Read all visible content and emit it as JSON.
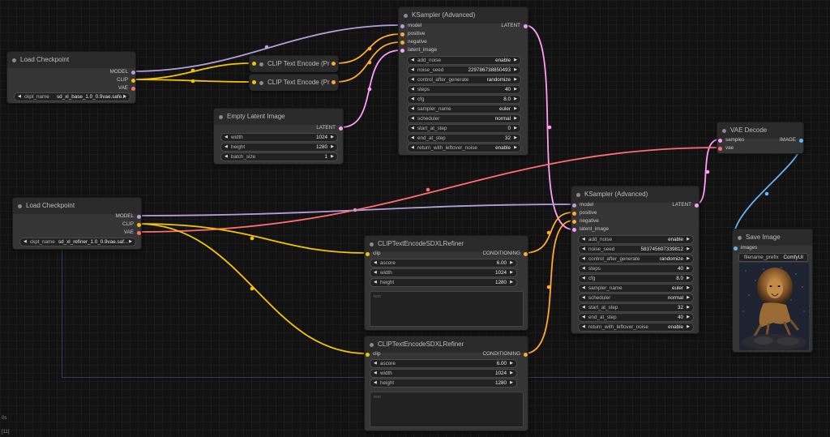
{
  "colors": {
    "model": "#b39ddb",
    "clip": "#f5c400",
    "vae": "#ff6e6e",
    "conditioning": "#ffa931",
    "latent": "#ff9cf9",
    "image": "#64b5f6",
    "canvas": "#121212",
    "node_body": "#353535",
    "node_title": "#2a2a2a"
  },
  "nodes": {
    "load_checkpoint_1": {
      "title": "Load Checkpoint",
      "outputs": [
        "MODEL",
        "CLIP",
        "VAE"
      ],
      "ckpt_label": "ckpt_name",
      "ckpt_value": "sd_xl_base_1.0_0.9vae.safe..."
    },
    "load_checkpoint_2": {
      "title": "Load Checkpoint",
      "outputs": [
        "MODEL",
        "CLIP",
        "VAE"
      ],
      "ckpt_label": "ckpt_name",
      "ckpt_value": "sd_xl_refiner_1.0_0.9vae.saf..."
    },
    "clip_encode_1": {
      "title": "CLIP Text Encode (Pr"
    },
    "clip_encode_2": {
      "title": "CLIP Text Encode (Pr"
    },
    "empty_latent": {
      "title": "Empty Latent Image",
      "output": "LATENT",
      "widgets": [
        {
          "name": "width",
          "value": "1024"
        },
        {
          "name": "height",
          "value": "1280"
        },
        {
          "name": "batch_size",
          "value": "1"
        }
      ]
    },
    "ksampler_1": {
      "title": "KSampler (Advanced)",
      "inputs": [
        "model",
        "positive",
        "negative",
        "latent_image"
      ],
      "output": "LATENT",
      "widgets": [
        {
          "name": "add_noise",
          "value": "enable"
        },
        {
          "name": "noise_seed",
          "value": "229786738850493"
        },
        {
          "name": "control_after_generate",
          "value": "randomize"
        },
        {
          "name": "steps",
          "value": "40"
        },
        {
          "name": "cfg",
          "value": "8.0"
        },
        {
          "name": "sampler_name",
          "value": "euler"
        },
        {
          "name": "scheduler",
          "value": "normal"
        },
        {
          "name": "start_at_step",
          "value": "0"
        },
        {
          "name": "end_at_step",
          "value": "32"
        },
        {
          "name": "return_with_leftover_noise",
          "value": "enable"
        }
      ]
    },
    "ksampler_2": {
      "title": "KSampler (Advanced)",
      "inputs": [
        "model",
        "positive",
        "negative",
        "latent_image"
      ],
      "output": "LATENT",
      "widgets": [
        {
          "name": "add_noise",
          "value": "enable"
        },
        {
          "name": "noise_seed",
          "value": "583745697339812"
        },
        {
          "name": "control_after_generate",
          "value": "randomize"
        },
        {
          "name": "steps",
          "value": "40"
        },
        {
          "name": "cfg",
          "value": "8.0"
        },
        {
          "name": "sampler_name",
          "value": "euler"
        },
        {
          "name": "scheduler",
          "value": "normal"
        },
        {
          "name": "start_at_step",
          "value": "32"
        },
        {
          "name": "end_at_step",
          "value": "40"
        },
        {
          "name": "return_with_leftover_noise",
          "value": "enable"
        }
      ]
    },
    "vae_decode": {
      "title": "VAE Decode",
      "inputs": [
        "samples",
        "vae"
      ],
      "output": "IMAGE"
    },
    "save_image": {
      "title": "Save Image",
      "input": "images",
      "prefix_label": "filename_prefix",
      "prefix_value": "ComfyUI"
    },
    "refiner_1": {
      "title": "CLIPTextEncodeSDXLRefiner",
      "input": "clip",
      "output": "CONDITIONING",
      "widgets": [
        {
          "name": "ascore",
          "value": "6.00"
        },
        {
          "name": "width",
          "value": "1024"
        },
        {
          "name": "height",
          "value": "1280"
        }
      ],
      "text_placeholder": "text"
    },
    "refiner_2": {
      "title": "CLIPTextEncodeSDXLRefiner",
      "input": "clip",
      "output": "CONDITIONING",
      "widgets": [
        {
          "name": "ascore",
          "value": "6.00"
        },
        {
          "name": "width",
          "value": "1024"
        },
        {
          "name": "height",
          "value": "1280"
        }
      ],
      "text_placeholder": "text"
    }
  },
  "footer": {
    "line1": "0s",
    "line2": "[11]"
  }
}
